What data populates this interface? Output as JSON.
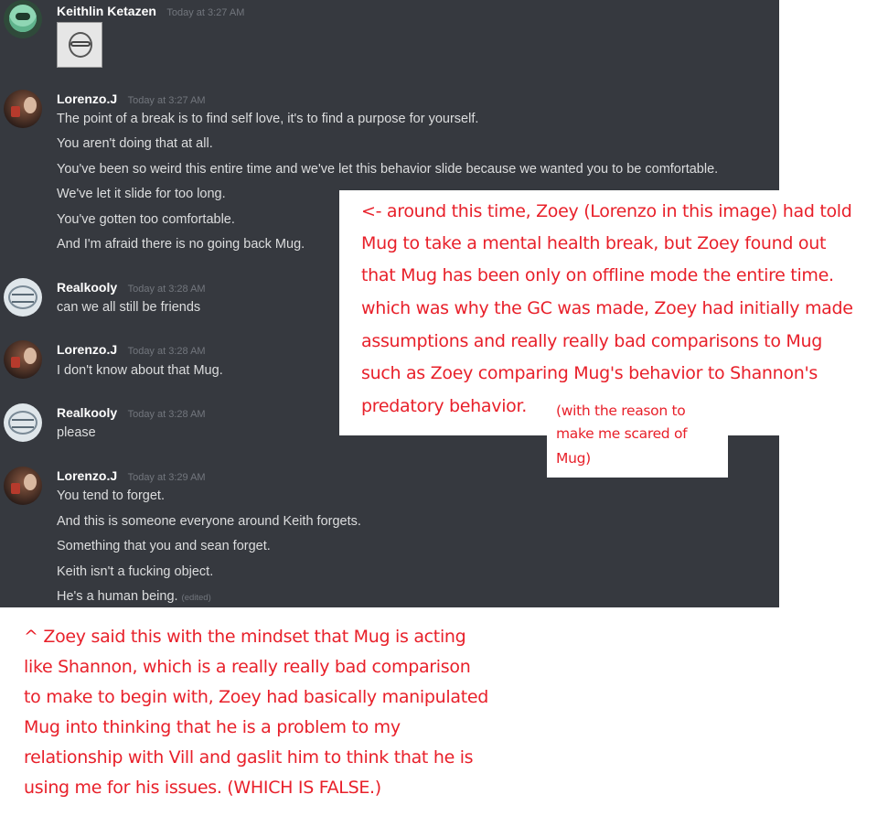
{
  "messages": [
    {
      "username": "Keithlin Ketazen",
      "timestamp": "Today at 3:27 AM",
      "lines": [],
      "attachment": "sticker-image"
    },
    {
      "username": "Lorenzo.J",
      "timestamp": "Today at 3:27 AM",
      "lines": [
        "The point of a break is to find self love, it's to find a purpose for yourself.",
        "You aren't doing that at all.",
        "You've been so weird this entire time and we've let this behavior slide because we wanted you to be comfortable.",
        "We've let it slide for too long.",
        "You've gotten too comfortable.",
        "And I'm afraid there is no going back Mug."
      ]
    },
    {
      "username": "Realkooly",
      "timestamp": "Today at 3:28 AM",
      "lines": [
        "can we all still be friends"
      ]
    },
    {
      "username": "Lorenzo.J",
      "timestamp": "Today at 3:28 AM",
      "lines": [
        "I don't know about that Mug."
      ]
    },
    {
      "username": "Realkooly",
      "timestamp": "Today at 3:28 AM",
      "lines": [
        "please"
      ]
    },
    {
      "username": "Lorenzo.J",
      "timestamp": "Today at 3:29 AM",
      "lines": [
        "You tend to forget.",
        "And this is someone everyone around Keith forgets.",
        "Something that you and sean forget.",
        "Keith isn't a fucking object.",
        "He's a human being."
      ],
      "edited_label": "(edited)"
    }
  ],
  "annotations": {
    "right_note": [
      "<- around this time, Zoey (Lorenzo in this image) had told",
      "Mug to take a mental health break, but Zoey found out",
      "that Mug has been only on offline mode the entire time.",
      "which was why the GC was made, Zoey had initially made",
      "assumptions and really really bad comparisons to Mug",
      "such as Zoey comparing Mug's behavior to Shannon's",
      "predatory behavior."
    ],
    "small_note": [
      "(with the reason to",
      "make me scared of",
      "Mug)"
    ],
    "bottom_note": [
      "^ Zoey said this with the mindset that Mug is acting",
      "like Shannon, which is a really really bad comparison",
      "to make to begin with, Zoey had basically manipulated",
      "Mug into thinking that he is a problem to my",
      "relationship with Vill and gaslit him to think that he is",
      "using me for his issues. (WHICH IS FALSE.)"
    ]
  },
  "colors": {
    "chat_background": "#36393f",
    "username": "#ffffff",
    "message_text": "#dcddde",
    "timestamp": "#72767d",
    "annotation_red": "#e8202a"
  }
}
